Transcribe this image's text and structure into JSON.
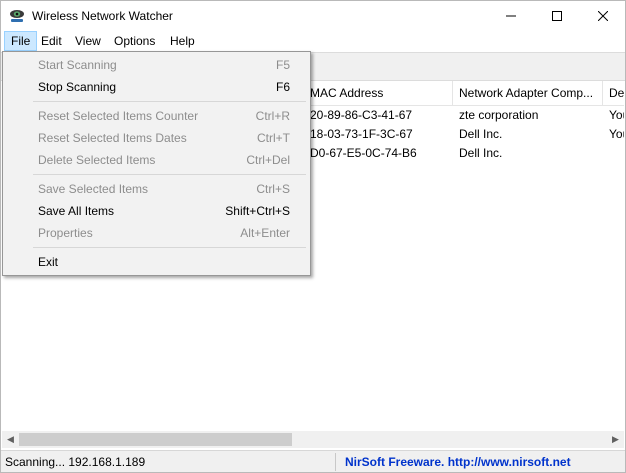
{
  "window": {
    "title": "Wireless Network Watcher"
  },
  "menubar": {
    "items": [
      "File",
      "Edit",
      "View",
      "Options",
      "Help"
    ]
  },
  "list": {
    "columns": [
      "MAC Address",
      "Network Adapter Comp...",
      "Dev"
    ],
    "rows": [
      {
        "mac": "20-89-86-C3-41-67",
        "vendor": "zte corporation",
        "device": "You"
      },
      {
        "mac": "18-03-73-1F-3C-67",
        "vendor": "Dell Inc.",
        "device": "You"
      },
      {
        "mac": "D0-67-E5-0C-74-B6",
        "vendor": "Dell Inc.",
        "device": ""
      }
    ]
  },
  "file_menu": {
    "items": [
      {
        "label": "Start Scanning",
        "shortcut": "F5",
        "enabled": false
      },
      {
        "label": "Stop Scanning",
        "shortcut": "F6",
        "enabled": true
      },
      {
        "label": "Reset Selected Items Counter",
        "shortcut": "Ctrl+R",
        "enabled": false
      },
      {
        "label": "Reset Selected Items Dates",
        "shortcut": "Ctrl+T",
        "enabled": false
      },
      {
        "label": "Delete Selected Items",
        "shortcut": "Ctrl+Del",
        "enabled": false
      },
      {
        "label": "Save Selected Items",
        "shortcut": "Ctrl+S",
        "enabled": false
      },
      {
        "label": "Save All Items",
        "shortcut": "Shift+Ctrl+S",
        "enabled": true
      },
      {
        "label": "Properties",
        "shortcut": "Alt+Enter",
        "enabled": false
      },
      {
        "label": "Exit",
        "shortcut": "",
        "enabled": true
      }
    ]
  },
  "status": {
    "left": "Scanning... 192.168.1.189",
    "right": "NirSoft Freeware.  http://www.nirsoft.net"
  },
  "colors": {
    "menu_highlight": "#cce8ff",
    "link": "#0033cc"
  }
}
